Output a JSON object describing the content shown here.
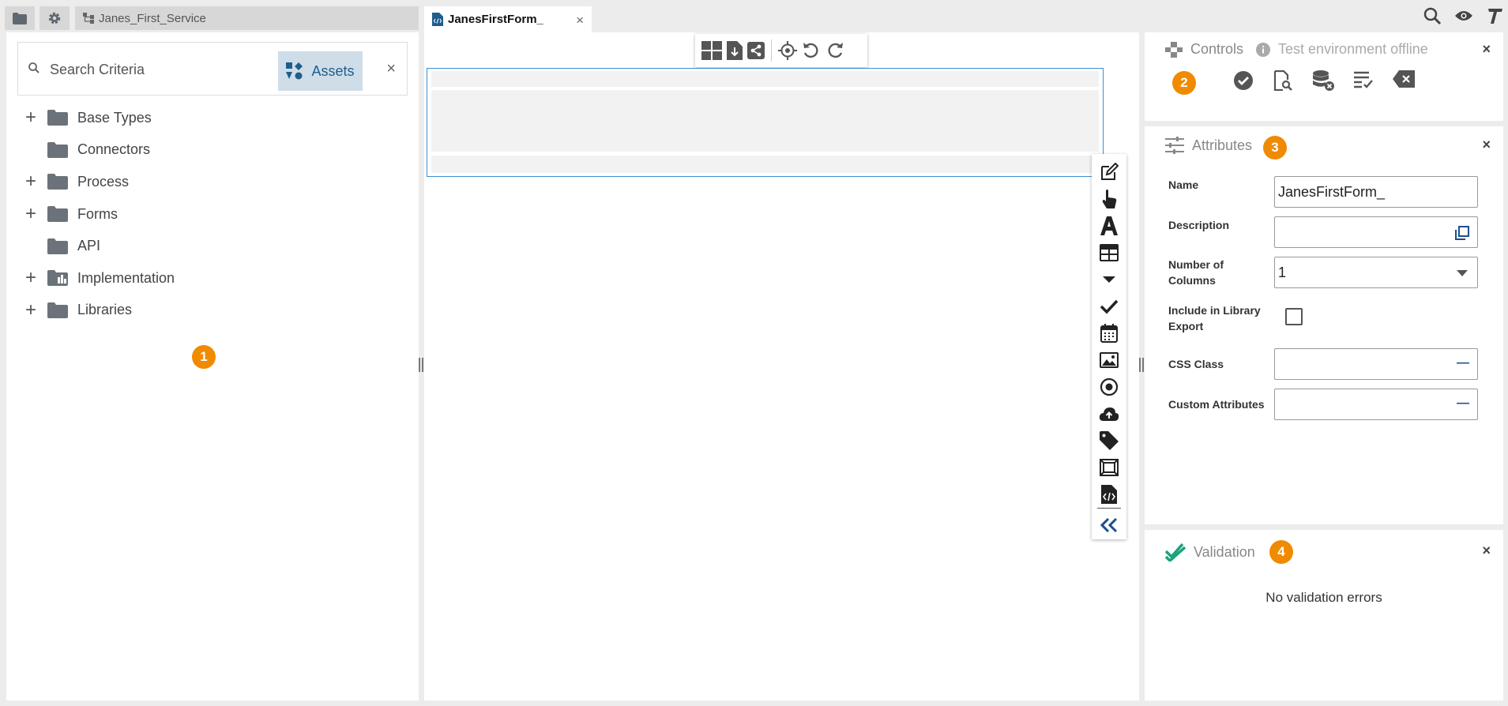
{
  "tabs": {
    "service": "Janes_First_Service",
    "form": "JanesFirstForm_",
    "close_symbol": "×"
  },
  "search": {
    "placeholder": "Search Criteria",
    "assets_label": "Assets",
    "clear_symbol": "×"
  },
  "tree": [
    {
      "label": "Base Types",
      "expandable": true
    },
    {
      "label": "Connectors",
      "expandable": false
    },
    {
      "label": "Process",
      "expandable": true
    },
    {
      "label": "Forms",
      "expandable": true
    },
    {
      "label": "API",
      "expandable": false
    },
    {
      "label": "Implementation",
      "expandable": true
    },
    {
      "label": "Libraries",
      "expandable": true
    }
  ],
  "tree_expand_symbol": "+",
  "badges": {
    "b1": "1",
    "b2": "2",
    "b3": "3",
    "b4": "4"
  },
  "controls": {
    "title": "Controls",
    "env_status": "Test environment offline",
    "close_symbol": "×"
  },
  "attributes": {
    "title": "Attributes",
    "close_symbol": "×",
    "name_label": "Name",
    "name_value": "JanesFirstForm_",
    "description_label": "Description",
    "columns_label_1": "Number of",
    "columns_label_2": "Columns",
    "columns_value": "1",
    "library_label_1": "Include in Library",
    "library_label_2": "Export",
    "css_label": "CSS Class",
    "custom_label": "Custom Attributes",
    "minus_symbol": "—"
  },
  "validation": {
    "title": "Validation",
    "close_symbol": "×",
    "message": "No validation errors"
  },
  "colors": {
    "accent_blue": "#1f5d8c",
    "badge_orange": "#f08a00",
    "validation_green": "#1aa37a"
  }
}
